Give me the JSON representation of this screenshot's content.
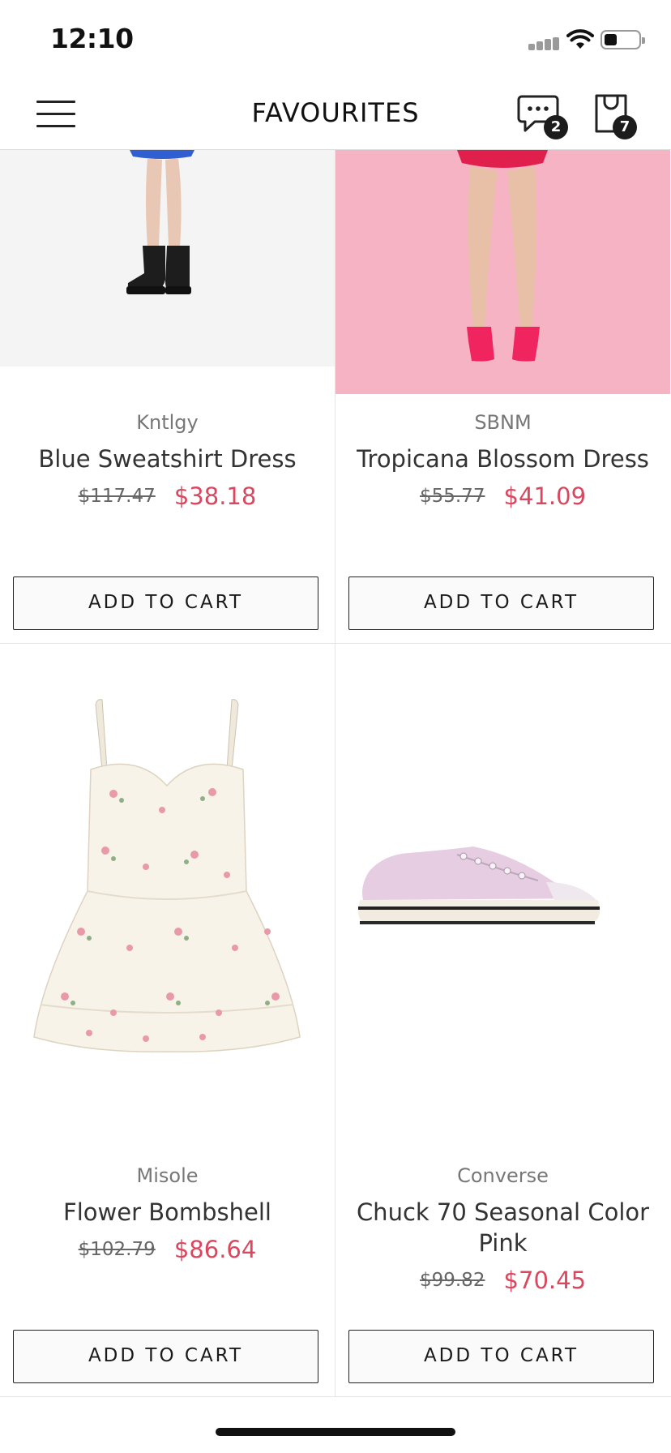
{
  "status_bar": {
    "time": "12:10"
  },
  "header": {
    "title": "FAVOURITES",
    "chat_badge": "2",
    "bag_badge": "7"
  },
  "colors": {
    "sale_price": "#d9485f",
    "pink_backdrop": "#f7b6c6",
    "badge": "#1c1c1c"
  },
  "products": [
    {
      "brand": "Kntlgy",
      "name": "Blue Sweatshirt Dress",
      "old_price": "$117.47",
      "price": "$38.18",
      "cta": "ADD TO CART"
    },
    {
      "brand": "SBNM",
      "name": "Tropicana Blossom Dress",
      "old_price": "$55.77",
      "price": "$41.09",
      "cta": "ADD TO CART"
    },
    {
      "brand": "Misole",
      "name": "Flower Bombshell",
      "old_price": "$102.79",
      "price": "$86.64",
      "cta": "ADD TO CART"
    },
    {
      "brand": "Converse",
      "name": "Chuck 70 Seasonal Color Pink",
      "old_price": "$99.82",
      "price": "$70.45",
      "cta": "ADD TO CART"
    }
  ]
}
